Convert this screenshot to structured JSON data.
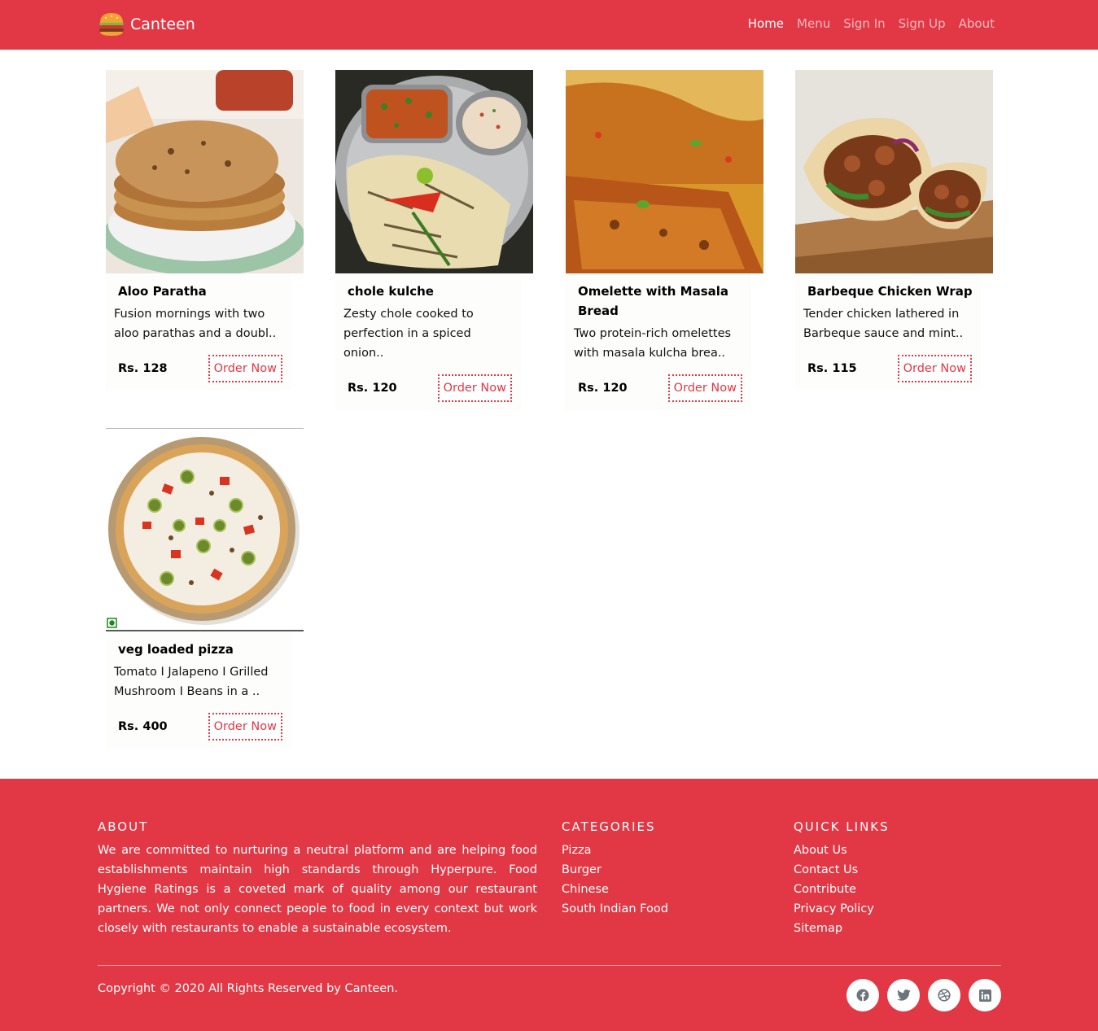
{
  "navbar": {
    "brand": "Canteen",
    "links": [
      "Home",
      "Menu",
      "Sign In",
      "Sign Up",
      "About"
    ]
  },
  "products": [
    {
      "name": "Aloo Paratha",
      "description": "Fusion mornings with two aloo parathas and a doubl..",
      "price": "Rs. 128",
      "button": "Order Now"
    },
    {
      "name": "chole kulche",
      "description": "Zesty chole cooked to perfection in a spiced onion..",
      "price": "Rs. 120",
      "button": "Order Now"
    },
    {
      "name": "Omelette with Masala Bread",
      "description": "Two protein-rich omelettes with masala kulcha brea..",
      "price": "Rs. 120",
      "button": "Order Now"
    },
    {
      "name": "Barbeque Chicken Wrap",
      "description": "Tender chicken lathered in Barbeque sauce and mint..",
      "price": "Rs. 115",
      "button": "Order Now"
    },
    {
      "name": "veg loaded pizza",
      "description": "Tomato I Jalapeno I Grilled Mushroom I Beans in a ..",
      "price": "Rs. 400",
      "button": "Order Now"
    }
  ],
  "footer": {
    "about": {
      "heading": "ABOUT",
      "text": "We are committed to nurturing a neutral platform and are helping food establishments maintain high standards through Hyperpure. Food Hygiene Ratings is a coveted mark of quality among our restaurant partners. We not only connect people to food in every context but work closely with restaurants to enable a sustainable ecosystem."
    },
    "categories": {
      "heading": "CATEGORIES",
      "items": [
        "Pizza",
        "Burger",
        "Chinese",
        "South Indian Food"
      ]
    },
    "quick_links": {
      "heading": "QUICK LINKS",
      "items": [
        "About Us",
        "Contact Us",
        "Contribute",
        "Privacy Policy",
        "Sitemap"
      ]
    },
    "copyright": "Copyright © 2020 All Rights Reserved by Canteen.",
    "socials": [
      "facebook-icon",
      "twitter-icon",
      "dribbble-icon",
      "linkedin-icon"
    ]
  },
  "colors": {
    "brand": "#e23744",
    "card_bg": "#fdfdfb",
    "veg_mark": "#1b8a1b"
  }
}
